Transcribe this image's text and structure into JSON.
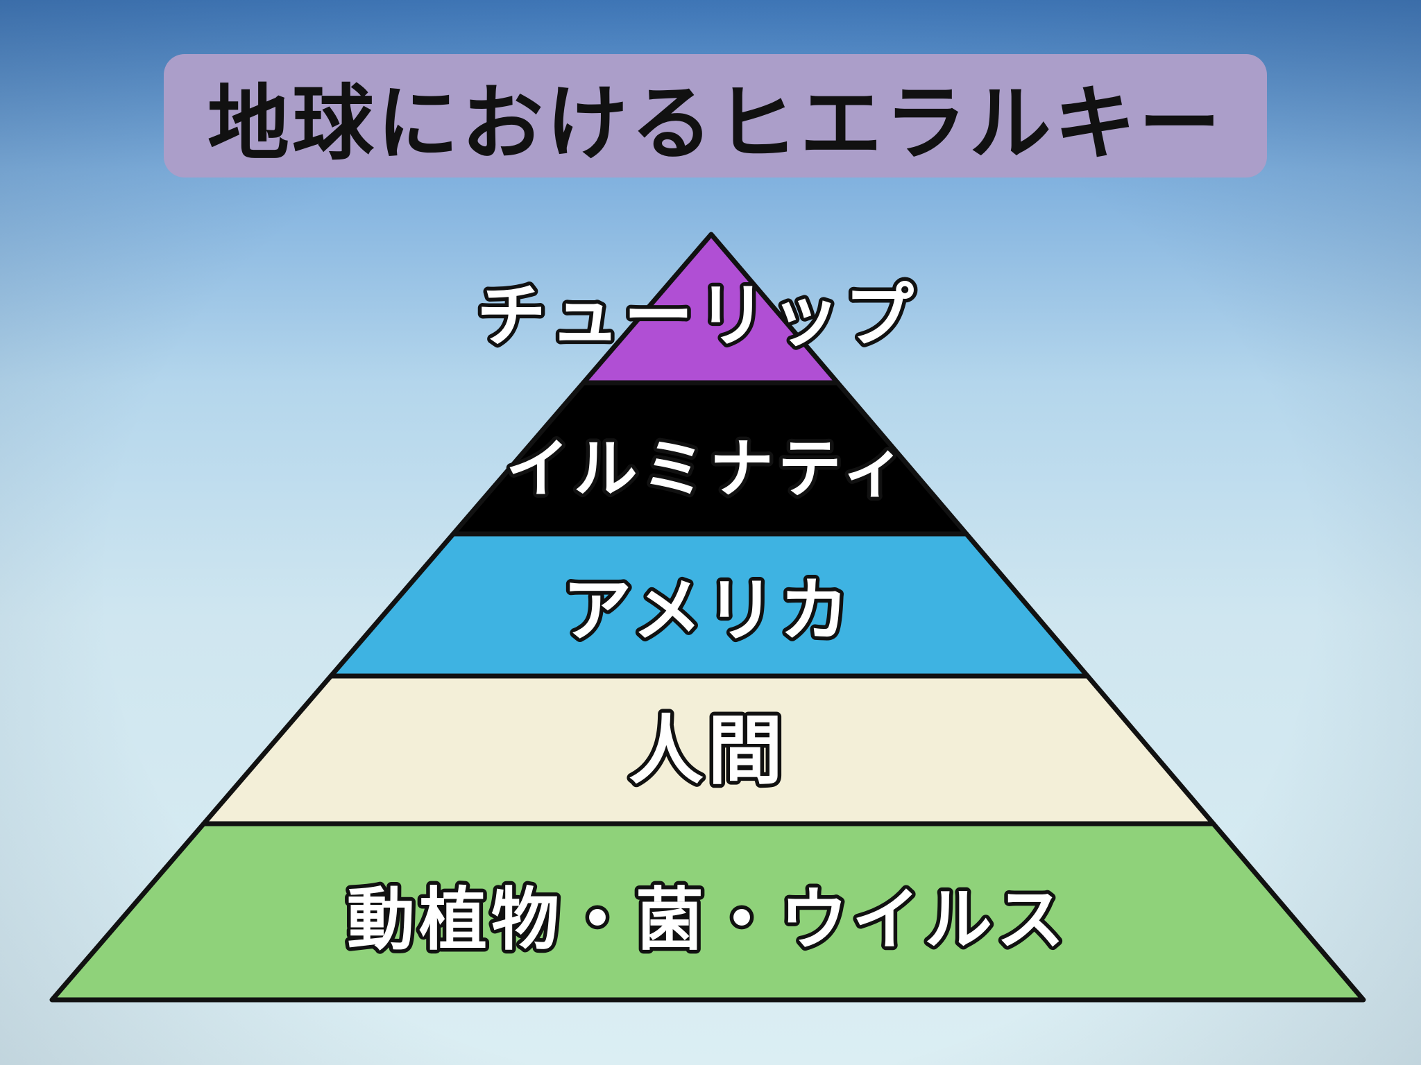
{
  "title": "地球におけるヒエラルキー",
  "layers": [
    {
      "label": "チューリップ",
      "color": "#b04fd4"
    },
    {
      "label": "イルミナティ",
      "color": "#000000"
    },
    {
      "label": "アメリカ",
      "color": "#3eb3e2"
    },
    {
      "label": "人間",
      "color": "#f3efd8"
    },
    {
      "label": "動植物・菌・ウイルス",
      "color": "#8fd27a"
    }
  ]
}
